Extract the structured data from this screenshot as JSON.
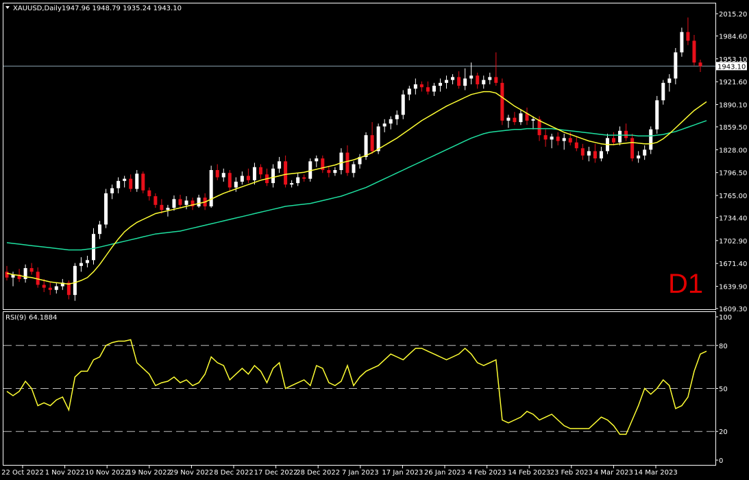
{
  "header": {
    "symbol": "XAUUSD,Daily",
    "ohlc": "1947.96 1948.79 1935.24 1943.10",
    "timeframe_label": "D1"
  },
  "colors": {
    "background": "#000000",
    "bull": "#ffffff",
    "bear": "#e8101a",
    "ma_fast": "#ffff33",
    "ma_slow": "#1ee0a0",
    "rsi": "#ffff33",
    "label": "#ffffff",
    "d1_label": "#e00000"
  },
  "chart_data": [
    {
      "type": "candlestick",
      "title": "XAUUSD,Daily",
      "ylim": [
        1609.3,
        2015.2
      ],
      "y_ticks": [
        "2015.20",
        "1984.60",
        "1953.10",
        "1921.60",
        "1890.10",
        "1859.50",
        "1828.00",
        "1796.50",
        "1765.00",
        "1734.40",
        "1702.90",
        "1671.40",
        "1639.90",
        "1609.30"
      ],
      "current_price": "1943.10",
      "x_tick_labels": [
        "22 Oct 2022",
        "1 Nov 2022",
        "10 Nov 2022",
        "19 Nov 2022",
        "29 Nov 2022",
        "8 Dec 2022",
        "17 Dec 2022",
        "28 Dec 2022",
        "7 Jan 2023",
        "17 Jan 2023",
        "26 Jan 2023",
        "4 Feb 2023",
        "14 Feb 2023",
        "23 Feb 2023",
        "4 Mar 2023",
        "14 Mar 2023"
      ],
      "candles": [
        [
          1660,
          1668,
          1648,
          1652
        ],
        [
          1652,
          1660,
          1640,
          1656
        ],
        [
          1656,
          1664,
          1646,
          1650
        ],
        [
          1650,
          1670,
          1645,
          1665
        ],
        [
          1665,
          1672,
          1656,
          1660
        ],
        [
          1660,
          1666,
          1638,
          1642
        ],
        [
          1642,
          1650,
          1632,
          1638
        ],
        [
          1638,
          1645,
          1628,
          1635
        ],
        [
          1635,
          1645,
          1630,
          1640
        ],
        [
          1640,
          1650,
          1635,
          1645
        ],
        [
          1645,
          1648,
          1622,
          1628
        ],
        [
          1628,
          1672,
          1620,
          1668
        ],
        [
          1668,
          1680,
          1660,
          1672
        ],
        [
          1672,
          1682,
          1666,
          1676
        ],
        [
          1676,
          1720,
          1670,
          1712
        ],
        [
          1712,
          1730,
          1705,
          1725
        ],
        [
          1725,
          1774,
          1720,
          1768
        ],
        [
          1768,
          1780,
          1760,
          1775
        ],
        [
          1775,
          1790,
          1768,
          1785
        ],
        [
          1785,
          1792,
          1776,
          1788
        ],
        [
          1788,
          1794,
          1770,
          1774
        ],
        [
          1774,
          1800,
          1770,
          1795
        ],
        [
          1795,
          1798,
          1768,
          1772
        ],
        [
          1772,
          1776,
          1758,
          1764
        ],
        [
          1764,
          1768,
          1748,
          1752
        ],
        [
          1752,
          1760,
          1740,
          1745
        ],
        [
          1745,
          1752,
          1736,
          1748
        ],
        [
          1748,
          1765,
          1744,
          1760
        ],
        [
          1760,
          1766,
          1748,
          1752
        ],
        [
          1752,
          1764,
          1746,
          1758
        ],
        [
          1758,
          1762,
          1745,
          1750
        ],
        [
          1750,
          1766,
          1748,
          1762
        ],
        [
          1762,
          1768,
          1745,
          1750
        ],
        [
          1750,
          1806,
          1748,
          1800
        ],
        [
          1800,
          1808,
          1786,
          1790
        ],
        [
          1790,
          1802,
          1784,
          1796
        ],
        [
          1796,
          1800,
          1770,
          1776
        ],
        [
          1776,
          1790,
          1770,
          1784
        ],
        [
          1784,
          1798,
          1780,
          1792
        ],
        [
          1792,
          1802,
          1782,
          1786
        ],
        [
          1786,
          1810,
          1780,
          1804
        ],
        [
          1804,
          1808,
          1788,
          1794
        ],
        [
          1794,
          1802,
          1778,
          1782
        ],
        [
          1782,
          1808,
          1776,
          1802
        ],
        [
          1802,
          1818,
          1796,
          1812
        ],
        [
          1812,
          1820,
          1776,
          1780
        ],
        [
          1780,
          1786,
          1776,
          1782
        ],
        [
          1782,
          1796,
          1778,
          1790
        ],
        [
          1790,
          1794,
          1784,
          1788
        ],
        [
          1788,
          1816,
          1784,
          1812
        ],
        [
          1812,
          1820,
          1804,
          1816
        ],
        [
          1816,
          1820,
          1796,
          1800
        ],
        [
          1800,
          1806,
          1790,
          1796
        ],
        [
          1796,
          1804,
          1792,
          1800
        ],
        [
          1800,
          1830,
          1794,
          1824
        ],
        [
          1824,
          1834,
          1792,
          1796
        ],
        [
          1796,
          1812,
          1790,
          1808
        ],
        [
          1808,
          1822,
          1802,
          1818
        ],
        [
          1818,
          1852,
          1814,
          1848
        ],
        [
          1848,
          1866,
          1822,
          1826
        ],
        [
          1826,
          1864,
          1822,
          1860
        ],
        [
          1860,
          1870,
          1852,
          1864
        ],
        [
          1864,
          1874,
          1856,
          1870
        ],
        [
          1870,
          1882,
          1862,
          1876
        ],
        [
          1876,
          1910,
          1870,
          1904
        ],
        [
          1904,
          1916,
          1896,
          1912
        ],
        [
          1912,
          1926,
          1904,
          1918
        ],
        [
          1918,
          1922,
          1908,
          1914
        ],
        [
          1914,
          1922,
          1904,
          1908
        ],
        [
          1908,
          1920,
          1902,
          1916
        ],
        [
          1916,
          1926,
          1908,
          1920
        ],
        [
          1920,
          1930,
          1912,
          1924
        ],
        [
          1924,
          1932,
          1918,
          1928
        ],
        [
          1928,
          1936,
          1912,
          1916
        ],
        [
          1916,
          1940,
          1910,
          1926
        ],
        [
          1926,
          1948,
          1918,
          1930
        ],
        [
          1930,
          1934,
          1912,
          1918
        ],
        [
          1918,
          1930,
          1912,
          1924
        ],
        [
          1924,
          1934,
          1918,
          1928
        ],
        [
          1928,
          1962,
          1916,
          1920
        ],
        [
          1920,
          1926,
          1862,
          1868
        ],
        [
          1868,
          1876,
          1858,
          1872
        ],
        [
          1872,
          1880,
          1862,
          1866
        ],
        [
          1866,
          1884,
          1862,
          1878
        ],
        [
          1878,
          1886,
          1862,
          1868
        ],
        [
          1868,
          1874,
          1856,
          1870
        ],
        [
          1870,
          1874,
          1840,
          1848
        ],
        [
          1848,
          1856,
          1832,
          1842
        ],
        [
          1842,
          1850,
          1830,
          1846
        ],
        [
          1846,
          1852,
          1834,
          1840
        ],
        [
          1840,
          1850,
          1828,
          1844
        ],
        [
          1844,
          1852,
          1834,
          1838
        ],
        [
          1838,
          1846,
          1826,
          1830
        ],
        [
          1830,
          1836,
          1814,
          1820
        ],
        [
          1820,
          1832,
          1812,
          1826
        ],
        [
          1826,
          1836,
          1810,
          1816
        ],
        [
          1816,
          1832,
          1812,
          1826
        ],
        [
          1826,
          1850,
          1822,
          1844
        ],
        [
          1844,
          1852,
          1834,
          1838
        ],
        [
          1838,
          1860,
          1834,
          1854
        ],
        [
          1854,
          1864,
          1840,
          1844
        ],
        [
          1844,
          1850,
          1812,
          1816
        ],
        [
          1816,
          1826,
          1810,
          1820
        ],
        [
          1820,
          1834,
          1814,
          1828
        ],
        [
          1828,
          1860,
          1822,
          1856
        ],
        [
          1856,
          1902,
          1850,
          1896
        ],
        [
          1896,
          1924,
          1890,
          1920
        ],
        [
          1920,
          1932,
          1908,
          1926
        ],
        [
          1926,
          1968,
          1918,
          1962
        ],
        [
          1962,
          1996,
          1956,
          1990
        ],
        [
          1990,
          2010,
          1972,
          1978
        ],
        [
          1978,
          1986,
          1944,
          1948
        ],
        [
          1948,
          1952,
          1935,
          1943
        ]
      ],
      "ma_fast": [
        1658,
        1656,
        1655,
        1653,
        1652,
        1650,
        1648,
        1646,
        1645,
        1644,
        1643,
        1645,
        1648,
        1652,
        1660,
        1670,
        1682,
        1694,
        1705,
        1715,
        1722,
        1728,
        1732,
        1736,
        1740,
        1742,
        1744,
        1746,
        1748,
        1750,
        1752,
        1754,
        1756,
        1760,
        1764,
        1768,
        1771,
        1774,
        1777,
        1780,
        1783,
        1786,
        1788,
        1790,
        1792,
        1794,
        1795,
        1796,
        1797,
        1799,
        1801,
        1803,
        1805,
        1807,
        1810,
        1812,
        1814,
        1817,
        1820,
        1824,
        1829,
        1834,
        1839,
        1844,
        1850,
        1856,
        1862,
        1868,
        1873,
        1878,
        1883,
        1888,
        1892,
        1896,
        1900,
        1904,
        1906,
        1908,
        1908,
        1906,
        1900,
        1894,
        1888,
        1883,
        1878,
        1873,
        1868,
        1864,
        1860,
        1856,
        1852,
        1849,
        1846,
        1843,
        1840,
        1838,
        1836,
        1835,
        1835,
        1836,
        1837,
        1838,
        1837,
        1836,
        1836,
        1838,
        1843,
        1850,
        1858,
        1866,
        1874,
        1882,
        1888,
        1894
      ],
      "ma_slow": [
        1700,
        1699,
        1698,
        1697,
        1696,
        1695,
        1694,
        1693,
        1692,
        1691,
        1690,
        1690,
        1690,
        1691,
        1692,
        1694,
        1696,
        1698,
        1700,
        1702,
        1704,
        1706,
        1708,
        1710,
        1712,
        1713,
        1714,
        1715,
        1716,
        1718,
        1720,
        1722,
        1724,
        1726,
        1728,
        1730,
        1732,
        1734,
        1736,
        1738,
        1740,
        1742,
        1744,
        1746,
        1748,
        1750,
        1751,
        1752,
        1753,
        1754,
        1756,
        1758,
        1760,
        1762,
        1764,
        1767,
        1770,
        1773,
        1776,
        1780,
        1784,
        1788,
        1792,
        1796,
        1800,
        1804,
        1808,
        1812,
        1816,
        1820,
        1824,
        1828,
        1832,
        1836,
        1840,
        1844,
        1847,
        1850,
        1852,
        1853,
        1854,
        1855,
        1856,
        1856,
        1857,
        1857,
        1857,
        1857,
        1857,
        1856,
        1855,
        1854,
        1853,
        1852,
        1851,
        1850,
        1849,
        1848,
        1848,
        1848,
        1848,
        1848,
        1847,
        1847,
        1847,
        1848,
        1849,
        1851,
        1853,
        1856,
        1859,
        1862,
        1865,
        1868
      ]
    },
    {
      "type": "line",
      "title": "RSI(9)",
      "value_label": "64.1884",
      "ylim": [
        0,
        100
      ],
      "y_ticks": [
        "100",
        "80",
        "50",
        "20",
        "0"
      ],
      "levels": [
        80,
        50,
        20
      ],
      "values": [
        48,
        45,
        48,
        55,
        50,
        38,
        40,
        38,
        42,
        44,
        35,
        58,
        62,
        62,
        70,
        72,
        80,
        82,
        83,
        83,
        84,
        68,
        64,
        60,
        52,
        54,
        55,
        58,
        54,
        56,
        52,
        54,
        60,
        72,
        68,
        66,
        56,
        60,
        64,
        60,
        66,
        62,
        54,
        64,
        68,
        50,
        52,
        54,
        56,
        52,
        66,
        64,
        54,
        52,
        55,
        66,
        52,
        58,
        62,
        64,
        66,
        70,
        74,
        72,
        70,
        74,
        78,
        78,
        76,
        74,
        72,
        70,
        72,
        74,
        78,
        74,
        68,
        66,
        68,
        70,
        28,
        26,
        28,
        30,
        34,
        32,
        28,
        30,
        32,
        28,
        24,
        22,
        22,
        22,
        22,
        26,
        30,
        28,
        24,
        18,
        18,
        28,
        38,
        50,
        46,
        50,
        56,
        52,
        36,
        38,
        44,
        62,
        74,
        76
      ],
      "x_tick_labels": [
        "22 Oct 2022",
        "1 Nov 2022",
        "10 Nov 2022",
        "19 Nov 2022",
        "29 Nov 2022",
        "8 Dec 2022",
        "17 Dec 2022",
        "28 Dec 2022",
        "7 Jan 2023",
        "17 Jan 2023",
        "26 Jan 2023",
        "4 Feb 2023",
        "14 Feb 2023",
        "23 Feb 2023",
        "4 Mar 2023",
        "14 Mar 2023"
      ]
    }
  ]
}
